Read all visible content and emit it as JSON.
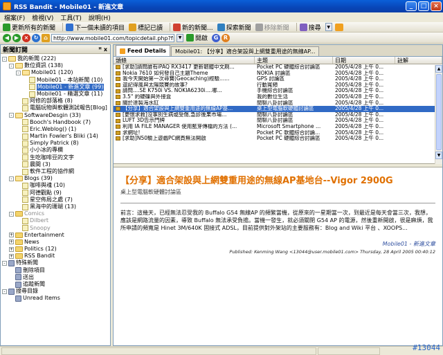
{
  "window": {
    "title": "RSS Bandit - Mobile01 - 新進文章",
    "controls": [
      "_",
      "□",
      "×"
    ]
  },
  "menu": [
    "檔案(F)",
    "檢視(V)",
    "工具(T)",
    "說明(H)"
  ],
  "toolbar1": [
    {
      "label": "更新所有的新聞",
      "color": "#2a9a2a"
    },
    {
      "label": "下一個未讀的項目",
      "color": "#3070d0"
    },
    {
      "label": "標記已讀",
      "color": "#e0a020"
    },
    {
      "label": "新的新聞...",
      "color": "#d04030"
    },
    {
      "label": "探索新聞",
      "color": "#3080c0"
    },
    {
      "label": "移除新聞",
      "color": "#a0a0a0"
    },
    {
      "label": "搜尋",
      "color": "#8060c0"
    }
  ],
  "toolbar2": {
    "url": "http://www.mobile01.com/topicdetail.php?f=174&t=75890",
    "open_label": "開啟"
  },
  "left_pane": {
    "title": "新聞訂閱",
    "pin": "ꟸ x",
    "tree": [
      {
        "d": 0,
        "exp": "-",
        "icon": "folder open",
        "label": "我的新聞 (222)"
      },
      {
        "d": 1,
        "exp": "-",
        "icon": "folder open",
        "label": "數位資訊 (138)"
      },
      {
        "d": 2,
        "exp": "-",
        "icon": "folder open",
        "label": "Mobile01 (120)"
      },
      {
        "d": 3,
        "exp": "",
        "icon": "feed",
        "label": "Mobile01 - 本站新聞 (10)"
      },
      {
        "d": 3,
        "exp": "",
        "icon": "feed",
        "label": "Mobile01 - 新進文章 (99)",
        "sel": true
      },
      {
        "d": 3,
        "exp": "",
        "icon": "feed",
        "label": "Mobile01 - 精選文章 (11)"
      },
      {
        "d": 2,
        "exp": "",
        "icon": "feed",
        "label": "阿修的部落格 (8)"
      },
      {
        "d": 2,
        "exp": "",
        "icon": "feed",
        "label": "電腦玩物與軟體測試報告[Blog]"
      },
      {
        "d": 1,
        "exp": "-",
        "icon": "folder open",
        "label": "SoftwareDesgin (33)"
      },
      {
        "d": 2,
        "exp": "",
        "icon": "feed",
        "label": "Booch's Handbook (7)"
      },
      {
        "d": 2,
        "exp": "",
        "icon": "feed",
        "label": "Eric.Weblog() (1)"
      },
      {
        "d": 2,
        "exp": "",
        "icon": "feed",
        "label": "Martin Fowler's Bliki (14)"
      },
      {
        "d": 2,
        "exp": "",
        "icon": "feed",
        "label": "Simply Patrick (8)"
      },
      {
        "d": 2,
        "exp": "",
        "icon": "feed",
        "label": "小小冰的專欄"
      },
      {
        "d": 2,
        "exp": "",
        "icon": "feed",
        "label": "生吃咖啡豆的文字"
      },
      {
        "d": 2,
        "exp": "",
        "icon": "feed",
        "label": "晨間 (3)"
      },
      {
        "d": 2,
        "exp": "",
        "icon": "feed",
        "label": "軟件工程的協作網"
      },
      {
        "d": 1,
        "exp": "-",
        "icon": "folder open",
        "label": "Blogs (39)"
      },
      {
        "d": 2,
        "exp": "",
        "icon": "feed",
        "label": "咖啡與魂 (10)"
      },
      {
        "d": 2,
        "exp": "",
        "icon": "feed",
        "label": "阿德觀點 (9)"
      },
      {
        "d": 2,
        "exp": "",
        "icon": "feed",
        "label": "星空佈局之處 (7)"
      },
      {
        "d": 2,
        "exp": "",
        "icon": "feed",
        "label": "黑海中的珊瑚 (13)"
      },
      {
        "d": 1,
        "exp": "-",
        "icon": "folder",
        "label": "Comics",
        "grey": true
      },
      {
        "d": 2,
        "exp": "",
        "icon": "feed",
        "label": "Dilbert",
        "grey": true
      },
      {
        "d": 2,
        "exp": "",
        "icon": "feed",
        "label": "Snoopy",
        "grey": true
      },
      {
        "d": 1,
        "exp": "+",
        "icon": "folder",
        "label": "Entertainment"
      },
      {
        "d": 1,
        "exp": "+",
        "icon": "folder",
        "label": "News"
      },
      {
        "d": 1,
        "exp": "+",
        "icon": "folder",
        "label": "Politics (12)"
      },
      {
        "d": 1,
        "exp": "+",
        "icon": "folder",
        "label": "RSS Bandit"
      },
      {
        "d": 0,
        "exp": "-",
        "icon": "special",
        "label": "特殊新聞"
      },
      {
        "d": 1,
        "exp": "",
        "icon": "special",
        "label": "刪除項目"
      },
      {
        "d": 1,
        "exp": "",
        "icon": "special",
        "label": "送出"
      },
      {
        "d": 1,
        "exp": "",
        "icon": "special",
        "label": "追蹤新聞"
      },
      {
        "d": 0,
        "exp": "-",
        "icon": "special",
        "label": "搜尋目錄"
      },
      {
        "d": 1,
        "exp": "",
        "icon": "special",
        "label": "Unread Items"
      }
    ]
  },
  "tabs": [
    {
      "label": "Feed Details",
      "active": true
    },
    {
      "label": "Mobile01: 【分享】適合架設與上網雙重用途的無線AP...",
      "active": false
    }
  ],
  "columns": [
    "頭條",
    "主題",
    "日期",
    "註解"
  ],
  "rows": [
    {
      "headline": "[求助]請問誰有iPAQ RX3417 更新韌體中文刷...",
      "topic": "Pocket PC 硬體綜合討論區",
      "date": "2005/4/28 上午 0..."
    },
    {
      "headline": "Nokia 7610 如何發自己主題Theme",
      "topic": "NOKIA 討論區",
      "date": "2005/4/28 上午 0..."
    },
    {
      "headline": "我今天開始第一次尋寶(Geocaching)經驗......",
      "topic": "GPS 討論區",
      "date": "2005/4/28 上午 0..."
    },
    {
      "headline": "還記得風與太陽競賽的故事?",
      "topic": "行動寬頻",
      "date": "2005/4/28 上午 0..."
    },
    {
      "headline": "請問....SE K750i   VS.   NOKIA6230i....哪...",
      "topic": "手機綜合討論區",
      "date": "2005/4/28 上午 0..."
    },
    {
      "headline": "3.5\" 的硬碟與外接盒",
      "topic": "我的數位生活",
      "date": "2005/4/28 上午 0..."
    },
    {
      "headline": "關於達製海水缸",
      "topic": "閒聊八卦討論區",
      "date": "2005/4/28 上午 0..."
    },
    {
      "headline": "【分享】適合架設與上網雙重用途的無線AP基...",
      "topic": "桌上型電腦軟硬體討論區",
      "date": "2005/4/28 上午 0...",
      "sel": true
    },
    {
      "headline": "[更懷求救]沒事別生病或受傷,急診後果市場...",
      "topic": "閒聊八卦討論區",
      "date": "2005/4/28 上午 0..."
    },
    {
      "headline": "LUFT 3D告示門牌",
      "topic": "閒聊八卦討論區",
      "date": "2005/4/28 上午 0..."
    },
    {
      "headline": "利用 IA FILE MANAGER 使用藍芽傳檔的方法 (...",
      "topic": "Microsoft Smartphone ...",
      "date": "2005/4/28 上午 0..."
    },
    {
      "headline": "求網址!",
      "topic": "Pocket PC 軟體綜合討論...",
      "date": "2005/4/28 上午 0..."
    },
    {
      "headline": "[求助]N50驗上遊戲PC網頁無法開啟",
      "topic": "Pocket PC 硬體綜合討論區",
      "date": "2005/4/28 上午 0..."
    }
  ],
  "detail": {
    "title": "【分享】適合架設與上網雙重用途的無線AP基地台--Vigor 2900G",
    "subtitle": "桌上型電腦軟硬體討論區",
    "body": "前言：這幾天，已經無法忍受我的 Buffalo G54 無線AP 的頻繁當機，從原來的一星期當一次，到最近是每天會當三次，我想，應該是網路流量的因素，導致 Buffalo 無法承受負擔。當機一發生，就必須關閉 G54 AP 的電源，然後重新開啟，很是麻煩，我所申請的頻寬是 Hinet 3M/640K 固接式 ADSL，目前提供對外架站的主要服務有：Blog and Wiki 平台 、XOOPS...",
    "link": "Mobile01 - 新進文章",
    "published": "Published: Kenming Wang <13044@user.mobile01.com> Thursday, 28 April 2005 00:40:12"
  },
  "watermark": "#13044"
}
